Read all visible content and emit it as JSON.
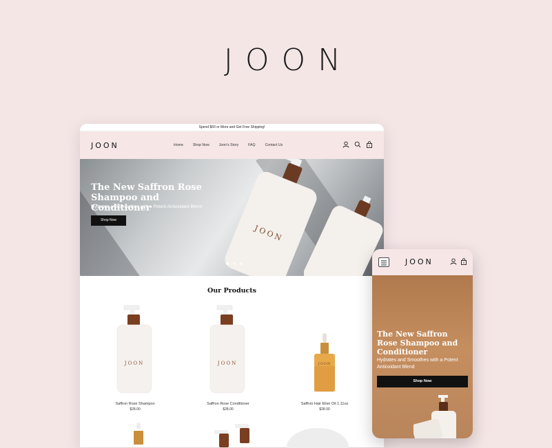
{
  "brand": {
    "logo": "JOON"
  },
  "desktop": {
    "announcement": "Spend $60 or More and Get Free Shipping!",
    "header": {
      "logo": "JOON",
      "nav": [
        "Home",
        "Shop Now",
        "Joon's Story",
        "FAQ",
        "Contact Us"
      ],
      "icons": [
        "user-icon",
        "search-icon",
        "cart-icon"
      ],
      "cart_count": "0"
    },
    "hero": {
      "title": "The New Saffron Rose Shampoo and Conditioner",
      "subtitle": "Hydrates and Smoothes with a Potent Antioxidant Blend",
      "button": "Shop Now",
      "bottle_brand": "JOON",
      "slide_count": 3,
      "active_slide": 1
    },
    "products": {
      "title": "Our Products",
      "items": [
        {
          "name": "Saffron Rose Shampoo",
          "price": "$28.00"
        },
        {
          "name": "Saffron Rose Conditioner",
          "price": "$28.00"
        },
        {
          "name": "Saffron Hair Elixir Oil 1.11oz",
          "price": "$28.00"
        }
      ]
    }
  },
  "mobile": {
    "header": {
      "logo": "JOON",
      "cart_count": "0"
    },
    "hero": {
      "title": "The New Saffron Rose Shampoo and Conditioner",
      "subtitle": "Hydrates and Smoothes with a Potent Antioxidant Blend",
      "button": "Shop Now"
    }
  },
  "colors": {
    "background": "#f5e6e6",
    "header": "#f6e6e6",
    "button": "#111111",
    "copper": "#8a4a2a"
  }
}
